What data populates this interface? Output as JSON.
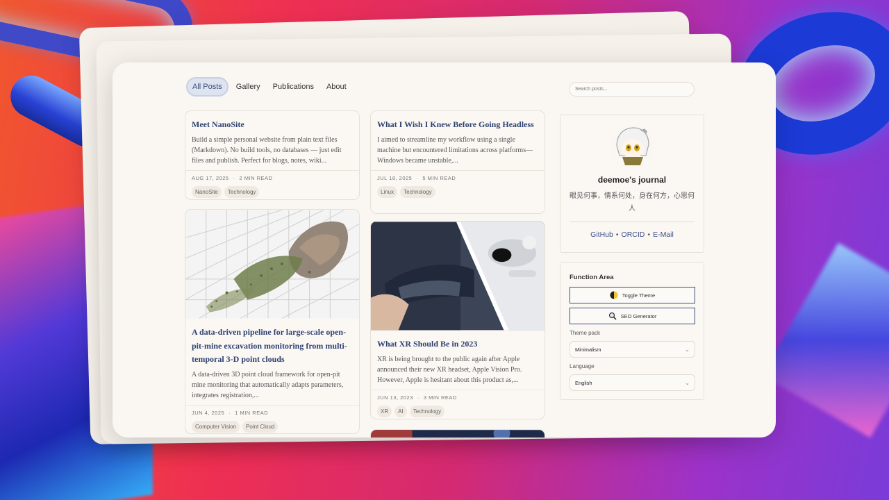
{
  "nav": {
    "items": [
      {
        "label": "All Posts"
      },
      {
        "label": "Gallery"
      },
      {
        "label": "Publications"
      },
      {
        "label": "About"
      }
    ],
    "search_placeholder": "Search posts..."
  },
  "posts": [
    {
      "title": "Meet NanoSite",
      "excerpt": "Build a simple personal website from plain text files (Markdown). No build tools, no databases — just edit files and publish. Perfect for blogs, notes, wiki...",
      "date": "AUG 17, 2025",
      "read": "2 MIN READ",
      "tags": [
        "NanoSite",
        "Technology"
      ]
    },
    {
      "title": "A data-driven pipeline for large-scale open-pit-mine excavation monitoring from multi-temporal 3-D point clouds",
      "excerpt": "A data-driven 3D point cloud framework for open-pit mine monitoring that automatically adapts parameters, integrates registration,...",
      "date": "JUN 4, 2025",
      "read": "1 MIN READ",
      "tags": [
        "Computer Vision",
        "Point Cloud"
      ]
    },
    {
      "title": "What I Wish I Knew Before Going Headless",
      "excerpt": "I aimed to streamline my workflow using a single machine but encountered limitations across platforms—Windows became unstable,...",
      "date": "JUL 18, 2025",
      "read": "5 MIN READ",
      "tags": [
        "Linux",
        "Technology"
      ]
    },
    {
      "title": "What XR Should Be in 2023",
      "excerpt": "XR is being brought to the public again after Apple announced their new XR headset, Apple Vision Pro. However, Apple is hesitant about this product as,...",
      "date": "JUN 13, 2023",
      "read": "3 MIN READ",
      "tags": [
        "XR",
        "AI",
        "Technology"
      ]
    }
  ],
  "profile": {
    "name": "deemoe's journal",
    "bio": "眼见何事，情系何处，身在何方，心思何人",
    "links": [
      "GitHub",
      "ORCID",
      "E-Mail"
    ],
    "link_sep": "•"
  },
  "functions": {
    "title": "Function Area",
    "toggle_theme": "Toggle Theme",
    "seo_generator": "SEO Generator",
    "theme_pack_label": "Theme pack",
    "theme_pack_value": "Minimalism",
    "language_label": "Language",
    "language_value": "English"
  },
  "colors": {
    "accent": "#2f4170",
    "page_bg": "#faf6f1"
  }
}
